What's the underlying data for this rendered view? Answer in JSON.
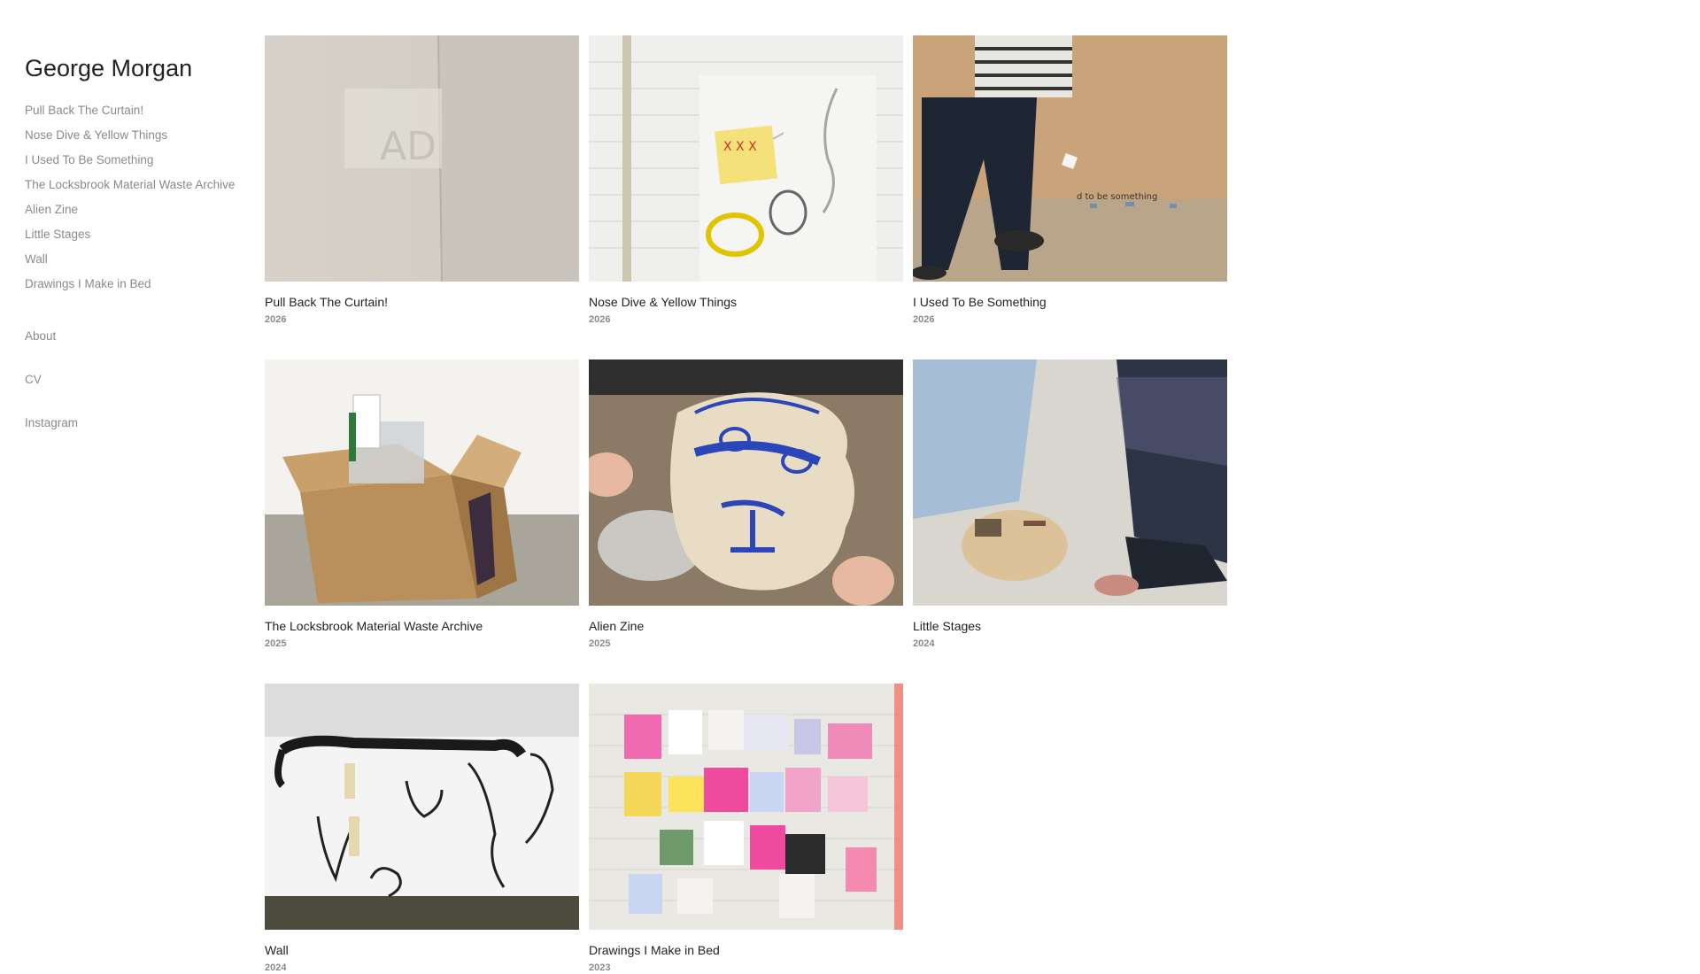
{
  "site": {
    "title": "George Morgan"
  },
  "nav": {
    "projects": [
      "Pull Back The Curtain!",
      "Nose Dive & Yellow Things",
      "I Used To Be Something",
      "The Locksbrook Material Waste Archive",
      "Alien Zine",
      "Little Stages",
      "Wall",
      "Drawings I Make in Bed"
    ],
    "secondary": [
      "About",
      "CV",
      "Instagram"
    ]
  },
  "works": [
    {
      "title": "Pull Back The Curtain!",
      "year": "2026"
    },
    {
      "title": "Nose Dive & Yellow Things",
      "year": "2026"
    },
    {
      "title": "I Used To Be Something",
      "year": "2026"
    },
    {
      "title": "The Locksbrook Material Waste Archive",
      "year": "2025"
    },
    {
      "title": "Alien Zine",
      "year": "2025"
    },
    {
      "title": "Little Stages",
      "year": "2024"
    },
    {
      "title": "Wall",
      "year": "2024"
    },
    {
      "title": "Drawings I Make in Bed",
      "year": "2023"
    }
  ],
  "colors": {
    "text": "#222222",
    "muted": "#8a8a8a",
    "background": "#ffffff"
  }
}
